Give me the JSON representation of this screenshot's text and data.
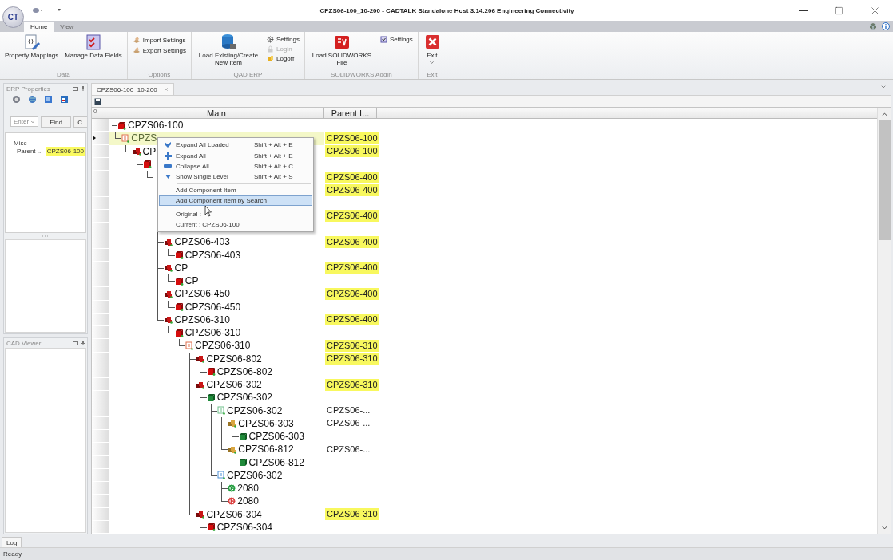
{
  "window": {
    "title": "CPZS06-100_10-200 - CADTALK Standalone Host 3.14.206 Engineering Connectivity",
    "app_logo": "CT"
  },
  "ribbon": {
    "tabs": [
      {
        "label": "Home",
        "selected": true
      },
      {
        "label": "View",
        "selected": false
      }
    ],
    "groups": [
      {
        "label": "Data",
        "buttons": [
          {
            "kind": "large",
            "label": "Property Mappings",
            "dropdown": false
          },
          {
            "kind": "large",
            "label": "Manage Data Fields",
            "dropdown": false
          }
        ]
      },
      {
        "label": "Options",
        "buttons": [
          {
            "kind": "small",
            "label": "Import Settings",
            "disabled": false
          },
          {
            "kind": "small",
            "label": "Export Settings",
            "disabled": false
          }
        ]
      },
      {
        "label": "QAD ERP",
        "buttons": [
          {
            "kind": "large",
            "label": "Load Existing/Create New Item",
            "dropdown": false
          },
          {
            "kind": "small",
            "label": "Settings",
            "disabled": false
          },
          {
            "kind": "small",
            "label": "Login",
            "disabled": true
          },
          {
            "kind": "small",
            "label": "Logoff",
            "disabled": false
          }
        ]
      },
      {
        "label": "SOLIDWORKS Addin",
        "buttons": [
          {
            "kind": "large",
            "label": "Load SOLIDWORKS File",
            "dropdown": false
          },
          {
            "kind": "small",
            "label": "Settings",
            "disabled": false
          }
        ]
      },
      {
        "label": "Exit",
        "buttons": [
          {
            "kind": "large",
            "label": "Exit",
            "dropdown": true
          }
        ]
      }
    ]
  },
  "erp_panel": {
    "title": "ERP Properties",
    "filter": {
      "value": "Enter",
      "find": "Find",
      "clear": "C"
    },
    "category": "Misc",
    "properties": [
      {
        "name": "Parent ...",
        "value": "CPZS06-100",
        "highlighted": true
      }
    ]
  },
  "cad_panel": {
    "title": "CAD Viewer"
  },
  "document": {
    "tab": "CPZS06-100_10-200",
    "grid": {
      "corner": "0",
      "columns": [
        {
          "label": "Main"
        },
        {
          "label": "Parent I..."
        }
      ],
      "tree": [
        {
          "name": "CPZS06-100",
          "kind": "part-red",
          "selected": false,
          "children": [
            {
              "name": "CPZS",
              "kind": "doc-red",
              "parent": "CPZS06-100",
              "parent_highlighted": true,
              "selected": true,
              "children": [
                {
                  "name": "CP",
                  "kind": "assembly-red",
                  "parent": "CPZS06-100",
                  "parent_highlighted": true,
                  "selected": false,
                  "children": [
                    {
                      "kind": "part-red",
                      "selected": false,
                      "children": [
                        {
                          "parent": "CPZS06-400",
                          "parent_highlighted": true,
                          "selected": false,
                          "children": [
                            {
                              "parent": "CPZS06-400",
                              "parent_highlighted": true,
                              "selected": false,
                              "children": [
                                {
                                  "selected": false
                                }
                              ]
                            },
                            {
                              "parent": "CPZS06-400",
                              "parent_highlighted": true,
                              "selected": false,
                              "children": [
                                {
                                  "selected": false
                                }
                              ]
                            },
                            {
                              "name": "CPZS06-403",
                              "kind": "assembly-red",
                              "parent": "CPZS06-400",
                              "parent_highlighted": true,
                              "selected": false,
                              "children": [
                                {
                                  "name": "CPZS06-403",
                                  "kind": "part-red",
                                  "selected": false
                                }
                              ]
                            },
                            {
                              "name": "CP",
                              "kind": "assembly-red",
                              "parent": "CPZS06-400",
                              "parent_highlighted": true,
                              "selected": false,
                              "children": [
                                {
                                  "name": "CP",
                                  "kind": "part-red",
                                  "selected": false
                                }
                              ]
                            },
                            {
                              "name": "CPZS06-450",
                              "kind": "assembly-red",
                              "parent": "CPZS06-400",
                              "parent_highlighted": true,
                              "selected": false,
                              "children": [
                                {
                                  "name": "CPZS06-450",
                                  "kind": "part-red",
                                  "selected": false
                                }
                              ]
                            },
                            {
                              "name": "CPZS06-310",
                              "kind": "assembly-red",
                              "parent": "CPZS06-400",
                              "parent_highlighted": true,
                              "selected": false,
                              "children": [
                                {
                                  "name": "CPZS06-310",
                                  "kind": "part-red",
                                  "selected": false,
                                  "children": [
                                    {
                                      "name": "CPZS06-310",
                                      "kind": "doc-red",
                                      "parent": "CPZS06-310",
                                      "parent_highlighted": true,
                                      "selected": false,
                                      "children": [
                                        {
                                          "name": "CPZS06-802",
                                          "kind": "assembly-red",
                                          "parent": "CPZS06-310",
                                          "parent_highlighted": true,
                                          "selected": false,
                                          "children": [
                                            {
                                              "name": "CPZS06-802",
                                              "kind": "part-red",
                                              "selected": false
                                            }
                                          ]
                                        },
                                        {
                                          "name": "CPZS06-302",
                                          "kind": "assembly-red",
                                          "parent": "CPZS06-310",
                                          "parent_highlighted": true,
                                          "selected": false,
                                          "children": [
                                            {
                                              "name": "CPZS06-302",
                                              "kind": "part-green",
                                              "selected": false,
                                              "children": [
                                                {
                                                  "name": "CPZS06-302",
                                                  "kind": "doc-green",
                                                  "parent": "CPZS06-...",
                                                  "parent_highlighted": false,
                                                  "selected": false,
                                                  "children": [
                                                    {
                                                      "name": "CPZS06-303",
                                                      "kind": "assembly-gold",
                                                      "parent": "CPZS06-...",
                                                      "parent_highlighted": false,
                                                      "selected": false,
                                                      "children": [
                                                        {
                                                          "name": "CPZS06-303",
                                                          "kind": "part-green",
                                                          "selected": false
                                                        }
                                                      ]
                                                    },
                                                    {
                                                      "name": "CPZS06-812",
                                                      "kind": "assembly-gold",
                                                      "parent": "CPZS06-...",
                                                      "parent_highlighted": false,
                                                      "selected": false,
                                                      "children": [
                                                        {
                                                          "name": "CPZS06-812",
                                                          "kind": "part-green",
                                                          "selected": false
                                                        }
                                                      ]
                                                    }
                                                  ]
                                                },
                                                {
                                                  "name": "CPZS06-302",
                                                  "kind": "doc-blue",
                                                  "selected": false,
                                                  "children": [
                                                    {
                                                      "name": "2080",
                                                      "kind": "gear-green",
                                                      "selected": false
                                                    },
                                                    {
                                                      "name": "2080",
                                                      "kind": "gear-red",
                                                      "selected": false
                                                    }
                                                  ]
                                                }
                                              ]
                                            }
                                          ]
                                        },
                                        {
                                          "name": "CPZS06-304",
                                          "kind": "assembly-red",
                                          "parent": "CPZS06-310",
                                          "parent_highlighted": true,
                                          "selected": false,
                                          "children": [
                                            {
                                              "name": "CPZS06-304",
                                              "kind": "part-red",
                                              "selected": false
                                            }
                                          ]
                                        }
                                      ]
                                    }
                                  ]
                                }
                              ]
                            }
                          ]
                        }
                      ]
                    }
                  ]
                }
              ]
            }
          ]
        }
      ]
    }
  },
  "context_menu": {
    "items": [
      {
        "kind": "command",
        "label": "Expand All Loaded",
        "shortcut": "Shift + Alt + E",
        "selected": false
      },
      {
        "kind": "command",
        "label": "Expand All",
        "shortcut": "Shift + Alt + E",
        "selected": false
      },
      {
        "kind": "command",
        "label": "Collapse All",
        "shortcut": "Shift + Alt + C",
        "selected": false
      },
      {
        "kind": "command",
        "label": "Show Single Level",
        "shortcut": "Shift + Alt + S",
        "selected": false
      },
      {
        "kind": "separator"
      },
      {
        "kind": "command",
        "label": "Add Component Item",
        "selected": false
      },
      {
        "kind": "command",
        "label": "Add Component Item by Search",
        "selected": true
      },
      {
        "kind": "separator"
      },
      {
        "kind": "info",
        "label": "Original :"
      },
      {
        "kind": "info",
        "label": "Current : CPZS06-100"
      }
    ]
  },
  "log_tab": "Log",
  "status_bar": {
    "text": "Ready"
  }
}
